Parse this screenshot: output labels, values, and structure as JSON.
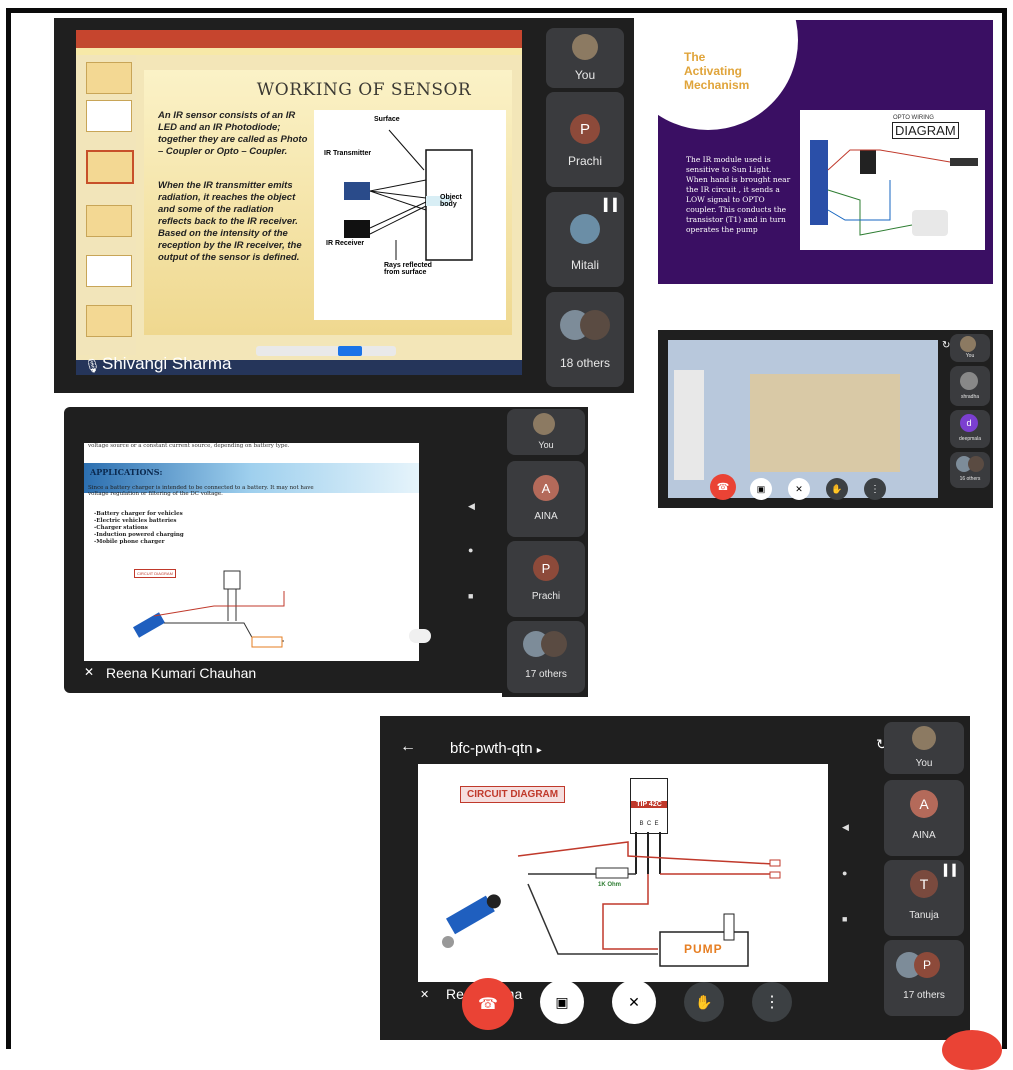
{
  "s1": {
    "slide_title": "WORKING OF SENSOR",
    "bullets": [
      "An IR sensor consists of an IR LED and an IR Photodiode; together they are called as Photo – Coupler or Opto – Coupler.",
      "When the IR transmitter emits radiation, it reaches the object and some of the radiation reflects back to the IR receiver. Based on the intensity of the reception by the IR receiver, the output of the sensor is defined."
    ],
    "diagram": {
      "surface": "Surface",
      "tx": "IR Transmitter",
      "rx": "IR Receiver",
      "object": "Object body",
      "rays": "Rays reflected from surface"
    },
    "presenter": "Shivangi Sharma",
    "participants": [
      {
        "initial": "",
        "name": "You"
      },
      {
        "initial": "P",
        "name": "Prachi"
      },
      {
        "initial": "",
        "name": "Mitali"
      },
      {
        "initial": "",
        "name": "18 others"
      }
    ]
  },
  "s2": {
    "title_lines": [
      "The",
      "Activating",
      "Mechanism"
    ],
    "text": "The IR module used is sensitive to Sun Light. When hand is brought near the IR circuit , it sends a LOW signal to OPTO coupler. This conducts the transistor (T1) and in turn operates the pump",
    "diagram_label": "DIAGRAM",
    "diagram_sub": "OPTO WIRING"
  },
  "s3": {
    "heading": "APPLICATIONS:",
    "intro": "voltage source or a constant current source, depending on battery type.",
    "desc": "Since a battery charger is intended to be connected to a battery. It may not have voltage regulation or filtering of the DC voltage.",
    "items": [
      "Battery charger for vehicles",
      "Electric vehicles batteries",
      "Charger stations",
      "Induction powered charging",
      "Mobile phone charger"
    ],
    "circuit_label": "CIRCUIT DIAGRAM",
    "presenter": "Reena Kumari Chauhan",
    "participants": [
      {
        "initial": "",
        "name": "You"
      },
      {
        "initial": "A",
        "name": "AINA"
      },
      {
        "initial": "P",
        "name": "Prachi"
      },
      {
        "initial": "",
        "name": "17 others"
      }
    ]
  },
  "s4": {
    "participants": [
      {
        "initial": "",
        "name": "You"
      },
      {
        "initial": "",
        "name": "shradha"
      },
      {
        "initial": "d",
        "name": "deepmala"
      },
      {
        "initial": "",
        "name": "16 others"
      }
    ]
  },
  "s5": {
    "meeting_code": "bfc-pwth-qtn",
    "circuit_label": "CIRCUIT DIAGRAM",
    "transistor": "TIP 42C",
    "pins": "B  C  E",
    "resistor": "1K Ohm",
    "pump": "PUMP",
    "presenter_visible": "Re        uma      uha",
    "participants": [
      {
        "initial": "",
        "name": "You"
      },
      {
        "initial": "A",
        "name": "AINA"
      },
      {
        "initial": "T",
        "name": "Tanuja"
      },
      {
        "initial": "P",
        "name": "17 others"
      }
    ]
  },
  "colors": {
    "accent": "#e0a43a",
    "avatar_p": "#8d4a3a",
    "avatar_a": "#b46a5a",
    "avatar_t": "#7a4a3e",
    "end_call": "#ea4335",
    "purple": "#3a0f63"
  }
}
